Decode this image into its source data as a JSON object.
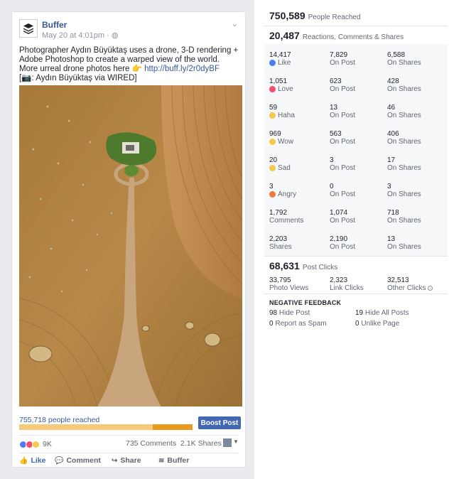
{
  "post": {
    "page_name": "Buffer",
    "timestamp": "May 20 at 4:01pm",
    "text_line1": "Photographer Aydın Büyüktaş uses a drone, 3-D rendering + Adobe Photoshop to create a warped view of the world.",
    "text_line2": "More urreal drone photos here",
    "link": "http://buff.ly/2r0dyBF",
    "credit": ": Aydın Büyüktaş via WIRED]",
    "people_reached": "755,718 people reached",
    "reach_fraction": 0.23,
    "boost_label": "Boost Post",
    "reactions_count": "9K",
    "comments": "735 Comments",
    "shares": "2.1K Shares",
    "actions": {
      "like": "Like",
      "comment": "Comment",
      "share": "Share",
      "buffer": "Buffer"
    }
  },
  "insights": {
    "people_reached": {
      "value": "750,589",
      "label": "People Reached"
    },
    "engagement": {
      "value": "20,487",
      "label": "Reactions, Comments & Shares"
    },
    "rows": [
      {
        "icon": "like-icon",
        "color": "#4d7cf2",
        "total": "14,417",
        "label": "Like",
        "on_post": "7,829",
        "on_shares": "6,588"
      },
      {
        "icon": "love-icon",
        "color": "#f0506e",
        "total": "1,051",
        "label": "Love",
        "on_post": "623",
        "on_shares": "428"
      },
      {
        "icon": "haha-icon",
        "color": "#f7c94b",
        "total": "59",
        "label": "Haha",
        "on_post": "13",
        "on_shares": "46"
      },
      {
        "icon": "wow-icon",
        "color": "#f7c94b",
        "total": "969",
        "label": "Wow",
        "on_post": "563",
        "on_shares": "406"
      },
      {
        "icon": "sad-icon",
        "color": "#f7c94b",
        "total": "20",
        "label": "Sad",
        "on_post": "3",
        "on_shares": "17"
      },
      {
        "icon": "angry-icon",
        "color": "#f07a3a",
        "total": "3",
        "label": "Angry",
        "on_post": "0",
        "on_shares": "3"
      },
      {
        "icon": "",
        "color": "",
        "total": "1,792",
        "label": "Comments",
        "on_post": "1,074",
        "on_shares": "718"
      },
      {
        "icon": "",
        "color": "",
        "total": "2,203",
        "label": "Shares",
        "on_post": "2,190",
        "on_shares": "13"
      }
    ],
    "on_post_label": "On Post",
    "on_shares_label": "On Shares",
    "post_clicks": {
      "value": "68,631",
      "label": "Post Clicks"
    },
    "clicks": [
      {
        "value": "33,795",
        "label": "Photo Views"
      },
      {
        "value": "2,323",
        "label": "Link Clicks"
      },
      {
        "value": "32,513",
        "label": "Other Clicks"
      }
    ],
    "negative": {
      "title": "NEGATIVE FEEDBACK",
      "hide_post": {
        "value": "98",
        "label": "Hide Post"
      },
      "hide_all": {
        "value": "19",
        "label": "Hide All Posts"
      },
      "spam": {
        "value": "0",
        "label": "Report as Spam"
      },
      "unlike": {
        "value": "0",
        "label": "Unlike Page"
      }
    }
  }
}
